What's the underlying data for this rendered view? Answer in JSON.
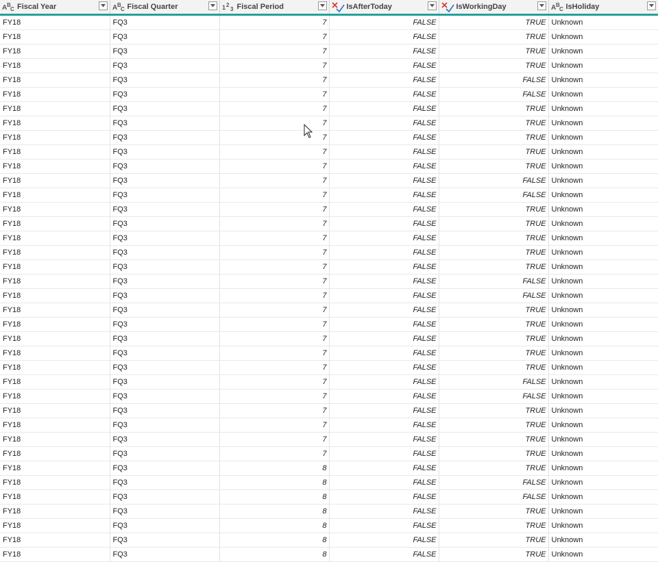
{
  "columns": [
    {
      "label": "Fiscal Year",
      "type_icon": "text-type-icon",
      "type_glyph": "ABC"
    },
    {
      "label": "Fiscal Quarter",
      "type_icon": "text-type-icon",
      "type_glyph": "ABC"
    },
    {
      "label": "Fiscal Period",
      "type_icon": "number-type-icon",
      "type_glyph": "123"
    },
    {
      "label": "IsAfterToday",
      "type_icon": "logical-type-icon",
      "type_glyph": "check-cross"
    },
    {
      "label": "IsWorkingDay",
      "type_icon": "logical-type-icon",
      "type_glyph": "check-cross"
    },
    {
      "label": "IsHoliday",
      "type_icon": "text-type-icon",
      "type_glyph": "ABC"
    }
  ],
  "rows": [
    [
      "FY18",
      "FQ3",
      "7",
      "FALSE",
      "TRUE",
      "Unknown"
    ],
    [
      "FY18",
      "FQ3",
      "7",
      "FALSE",
      "TRUE",
      "Unknown"
    ],
    [
      "FY18",
      "FQ3",
      "7",
      "FALSE",
      "TRUE",
      "Unknown"
    ],
    [
      "FY18",
      "FQ3",
      "7",
      "FALSE",
      "TRUE",
      "Unknown"
    ],
    [
      "FY18",
      "FQ3",
      "7",
      "FALSE",
      "FALSE",
      "Unknown"
    ],
    [
      "FY18",
      "FQ3",
      "7",
      "FALSE",
      "FALSE",
      "Unknown"
    ],
    [
      "FY18",
      "FQ3",
      "7",
      "FALSE",
      "TRUE",
      "Unknown"
    ],
    [
      "FY18",
      "FQ3",
      "7",
      "FALSE",
      "TRUE",
      "Unknown"
    ],
    [
      "FY18",
      "FQ3",
      "7",
      "FALSE",
      "TRUE",
      "Unknown"
    ],
    [
      "FY18",
      "FQ3",
      "7",
      "FALSE",
      "TRUE",
      "Unknown"
    ],
    [
      "FY18",
      "FQ3",
      "7",
      "FALSE",
      "TRUE",
      "Unknown"
    ],
    [
      "FY18",
      "FQ3",
      "7",
      "FALSE",
      "FALSE",
      "Unknown"
    ],
    [
      "FY18",
      "FQ3",
      "7",
      "FALSE",
      "FALSE",
      "Unknown"
    ],
    [
      "FY18",
      "FQ3",
      "7",
      "FALSE",
      "TRUE",
      "Unknown"
    ],
    [
      "FY18",
      "FQ3",
      "7",
      "FALSE",
      "TRUE",
      "Unknown"
    ],
    [
      "FY18",
      "FQ3",
      "7",
      "FALSE",
      "TRUE",
      "Unknown"
    ],
    [
      "FY18",
      "FQ3",
      "7",
      "FALSE",
      "TRUE",
      "Unknown"
    ],
    [
      "FY18",
      "FQ3",
      "7",
      "FALSE",
      "TRUE",
      "Unknown"
    ],
    [
      "FY18",
      "FQ3",
      "7",
      "FALSE",
      "FALSE",
      "Unknown"
    ],
    [
      "FY18",
      "FQ3",
      "7",
      "FALSE",
      "FALSE",
      "Unknown"
    ],
    [
      "FY18",
      "FQ3",
      "7",
      "FALSE",
      "TRUE",
      "Unknown"
    ],
    [
      "FY18",
      "FQ3",
      "7",
      "FALSE",
      "TRUE",
      "Unknown"
    ],
    [
      "FY18",
      "FQ3",
      "7",
      "FALSE",
      "TRUE",
      "Unknown"
    ],
    [
      "FY18",
      "FQ3",
      "7",
      "FALSE",
      "TRUE",
      "Unknown"
    ],
    [
      "FY18",
      "FQ3",
      "7",
      "FALSE",
      "TRUE",
      "Unknown"
    ],
    [
      "FY18",
      "FQ3",
      "7",
      "FALSE",
      "FALSE",
      "Unknown"
    ],
    [
      "FY18",
      "FQ3",
      "7",
      "FALSE",
      "FALSE",
      "Unknown"
    ],
    [
      "FY18",
      "FQ3",
      "7",
      "FALSE",
      "TRUE",
      "Unknown"
    ],
    [
      "FY18",
      "FQ3",
      "7",
      "FALSE",
      "TRUE",
      "Unknown"
    ],
    [
      "FY18",
      "FQ3",
      "7",
      "FALSE",
      "TRUE",
      "Unknown"
    ],
    [
      "FY18",
      "FQ3",
      "7",
      "FALSE",
      "TRUE",
      "Unknown"
    ],
    [
      "FY18",
      "FQ3",
      "8",
      "FALSE",
      "TRUE",
      "Unknown"
    ],
    [
      "FY18",
      "FQ3",
      "8",
      "FALSE",
      "FALSE",
      "Unknown"
    ],
    [
      "FY18",
      "FQ3",
      "8",
      "FALSE",
      "FALSE",
      "Unknown"
    ],
    [
      "FY18",
      "FQ3",
      "8",
      "FALSE",
      "TRUE",
      "Unknown"
    ],
    [
      "FY18",
      "FQ3",
      "8",
      "FALSE",
      "TRUE",
      "Unknown"
    ],
    [
      "FY18",
      "FQ3",
      "8",
      "FALSE",
      "TRUE",
      "Unknown"
    ],
    [
      "FY18",
      "FQ3",
      "8",
      "FALSE",
      "TRUE",
      "Unknown"
    ]
  ],
  "colors": {
    "header_underline": "#21a29a",
    "logical_cross": "#d9342b",
    "logical_check": "#2f6fc0"
  }
}
